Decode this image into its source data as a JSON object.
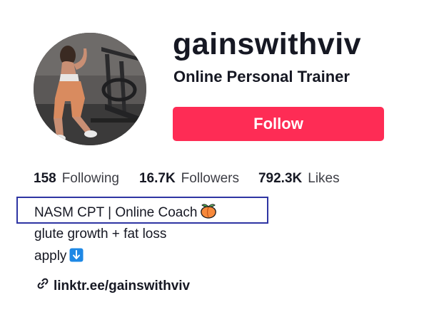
{
  "profile": {
    "username": "gainswithviv",
    "subtitle": "Online Personal Trainer",
    "follow_label": "Follow"
  },
  "stats": [
    {
      "value": "158",
      "label": "Following"
    },
    {
      "value": "16.7K",
      "label": "Followers"
    },
    {
      "value": "792.3K",
      "label": "Likes"
    }
  ],
  "bio": {
    "line1": "NASM CPT | Online Coach",
    "line1_icon": "peach-emoji-icon",
    "line2": "glute growth + fat loss",
    "line3": "apply",
    "line3_icon": "down-arrow-emoji-icon"
  },
  "link": {
    "icon": "link-icon",
    "text": "linktr.ee/gainswithviv"
  },
  "colors": {
    "accent": "#fe2c55",
    "text": "#161823",
    "highlight_border": "#2e35a3",
    "arrow_emoji": "#1e88e5"
  }
}
